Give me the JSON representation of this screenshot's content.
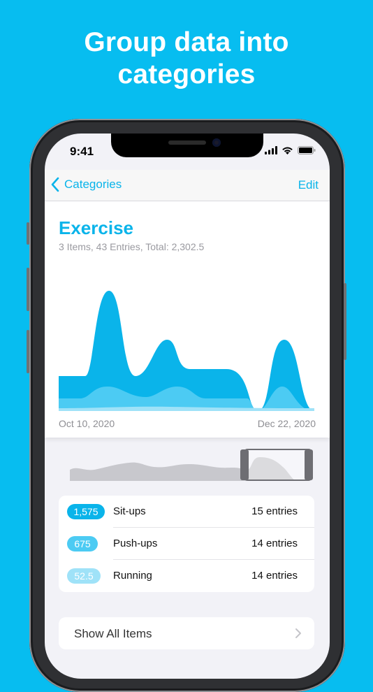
{
  "headline": {
    "line1": "Group data into",
    "line2": "categories"
  },
  "status": {
    "time": "9:41"
  },
  "nav": {
    "back_label": "Categories",
    "edit_label": "Edit"
  },
  "category": {
    "title": "Exercise",
    "subtitle": "3 Items, 43 Entries, Total: 2,302.5",
    "date_start": "Oct 10, 2020",
    "date_end": "Dec 22, 2020"
  },
  "items": [
    {
      "value": "1,575",
      "name": "Sit-ups",
      "entries": "15 entries",
      "color": "#0ab4ea"
    },
    {
      "value": "675",
      "name": "Push-ups",
      "entries": "14 entries",
      "color": "#4ccbf3"
    },
    {
      "value": "52.5",
      "name": "Running",
      "entries": "14 entries",
      "color": "#9fe2f8"
    }
  ],
  "show_all_label": "Show All Items",
  "colors": {
    "accent": "#0ab4ea",
    "background": "#07bdf0"
  }
}
